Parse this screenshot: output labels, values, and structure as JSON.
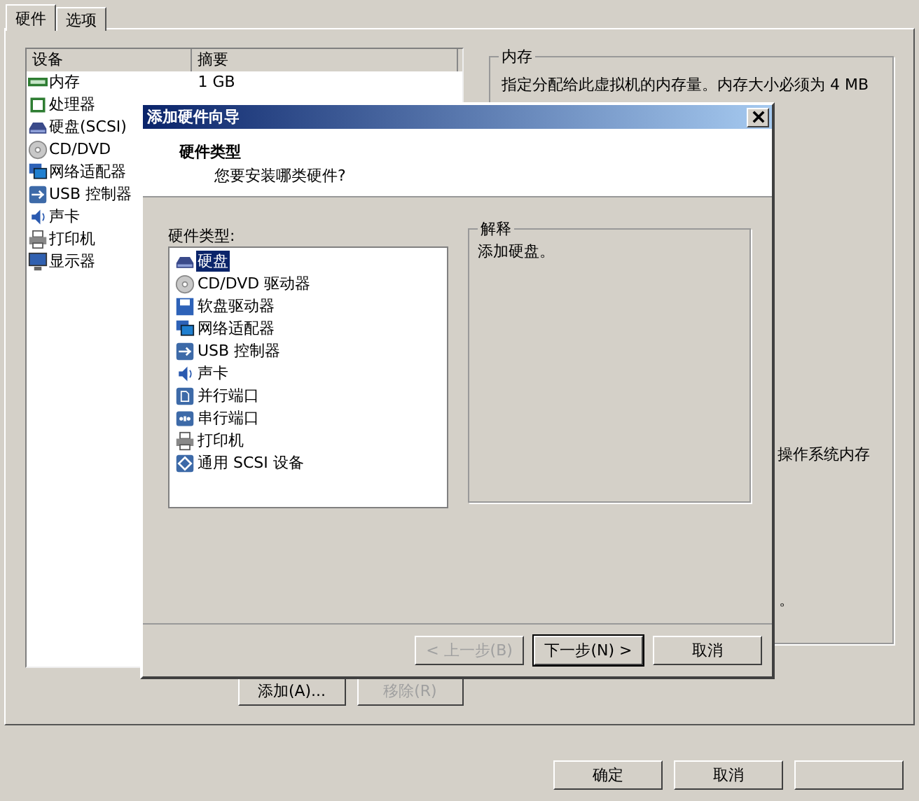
{
  "tabs": [
    {
      "label": "硬件",
      "selected": true
    },
    {
      "label": "选项",
      "selected": false
    }
  ],
  "device_list": {
    "columns": [
      "设备",
      "摘要"
    ],
    "rows": [
      {
        "kind": "memory",
        "device": "内存",
        "summary": "1 GB"
      },
      {
        "kind": "cpu",
        "device": "处理器"
      },
      {
        "kind": "disk",
        "device": "硬盘(SCSI)"
      },
      {
        "kind": "cdrom",
        "device": "CD/DVD"
      },
      {
        "kind": "network",
        "device": "网络适配器"
      },
      {
        "kind": "usb",
        "device": "USB 控制器"
      },
      {
        "kind": "sound",
        "device": "声卡"
      },
      {
        "kind": "printer",
        "device": "打印机"
      },
      {
        "kind": "display",
        "device": "显示器"
      }
    ]
  },
  "device_buttons": [
    {
      "label": "添加(A)...",
      "disabled": false
    },
    {
      "label": "移除(R)",
      "disabled": true
    }
  ],
  "memory_group": {
    "title": "内存",
    "description": "指定分配给此虚拟机的内存量。内存大小必须为 4 MB",
    "fragments": [
      "操作系统内存",
      "。"
    ]
  },
  "buttons": [
    {
      "label": "确定",
      "disabled": false
    },
    {
      "label": "取消",
      "disabled": false
    }
  ],
  "dialog": {
    "title": "添加硬件向导",
    "heading": "硬件类型",
    "subheading": "您要安装哪类硬件?",
    "list_label": "硬件类型:",
    "hardware_types": [
      {
        "kind": "disk",
        "label": "硬盘",
        "selected": true
      },
      {
        "kind": "cdrom",
        "label": "CD/DVD 驱动器",
        "selected": false
      },
      {
        "kind": "floppy",
        "label": "软盘驱动器",
        "selected": false
      },
      {
        "kind": "network",
        "label": "网络适配器",
        "selected": false
      },
      {
        "kind": "usb",
        "label": "USB 控制器",
        "selected": false
      },
      {
        "kind": "sound",
        "label": "声卡",
        "selected": false
      },
      {
        "kind": "parallel",
        "label": "并行端口",
        "selected": false
      },
      {
        "kind": "serial",
        "label": "串行端口",
        "selected": false
      },
      {
        "kind": "printer",
        "label": "打印机",
        "selected": false
      },
      {
        "kind": "scsi",
        "label": "通用 SCSI 设备",
        "selected": false
      }
    ],
    "explanation": {
      "title": "解释",
      "text": "添加硬盘。"
    },
    "buttons": [
      {
        "label": "< 上一步(B)",
        "disabled": true,
        "default": false
      },
      {
        "label": "下一步(N) >",
        "disabled": false,
        "default": true
      },
      {
        "label": "取消",
        "disabled": false,
        "default": false
      }
    ]
  }
}
